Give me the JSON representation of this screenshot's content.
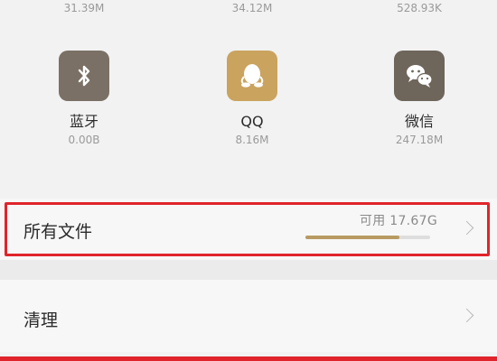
{
  "top_sizes": [
    "31.39M",
    "34.12M",
    "528.93K"
  ],
  "apps": [
    {
      "name": "蓝牙",
      "size": "0.00B",
      "icon": "bluetooth-icon",
      "color": "#7a7065"
    },
    {
      "name": "QQ",
      "size": "8.16M",
      "icon": "qq-penguin-icon",
      "color": "#caa35e"
    },
    {
      "name": "微信",
      "size": "247.18M",
      "icon": "wechat-icon",
      "color": "#6e655b"
    }
  ],
  "storage_row": {
    "label": "所有文件",
    "available": "可用 17.67G",
    "used_fraction": 0.75,
    "highlight_color": "#e0242b",
    "bar_color": "#b89b62"
  },
  "clean_row": {
    "label": "清理"
  }
}
